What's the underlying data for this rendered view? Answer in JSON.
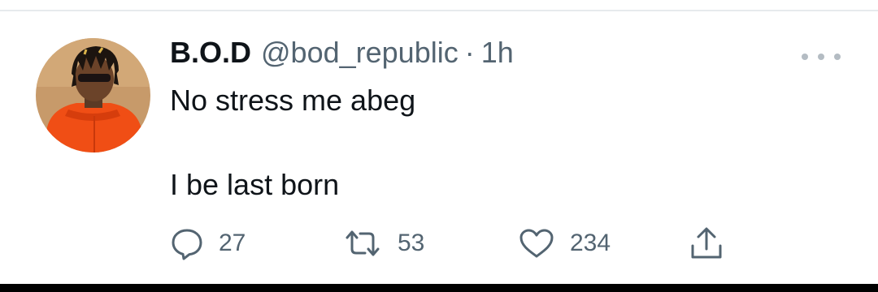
{
  "tweet": {
    "display_name": "B.O.D",
    "handle": "@bod_republic",
    "separator": "·",
    "time": "1h",
    "lines": [
      "No stress me abeg",
      "I be last born"
    ],
    "actions": {
      "reply": {
        "icon": "reply-icon",
        "count": "27"
      },
      "retweet": {
        "icon": "retweet-icon",
        "count": "53"
      },
      "like": {
        "icon": "heart-icon",
        "count": "234"
      },
      "share": {
        "icon": "share-icon"
      }
    },
    "more_icon": "more-options-icon"
  },
  "colors": {
    "text": "#0f1419",
    "secondary": "#536471",
    "divider": "#e7eaed",
    "avatar_bg": "#c79a6a",
    "shirt": "#f04e15"
  }
}
